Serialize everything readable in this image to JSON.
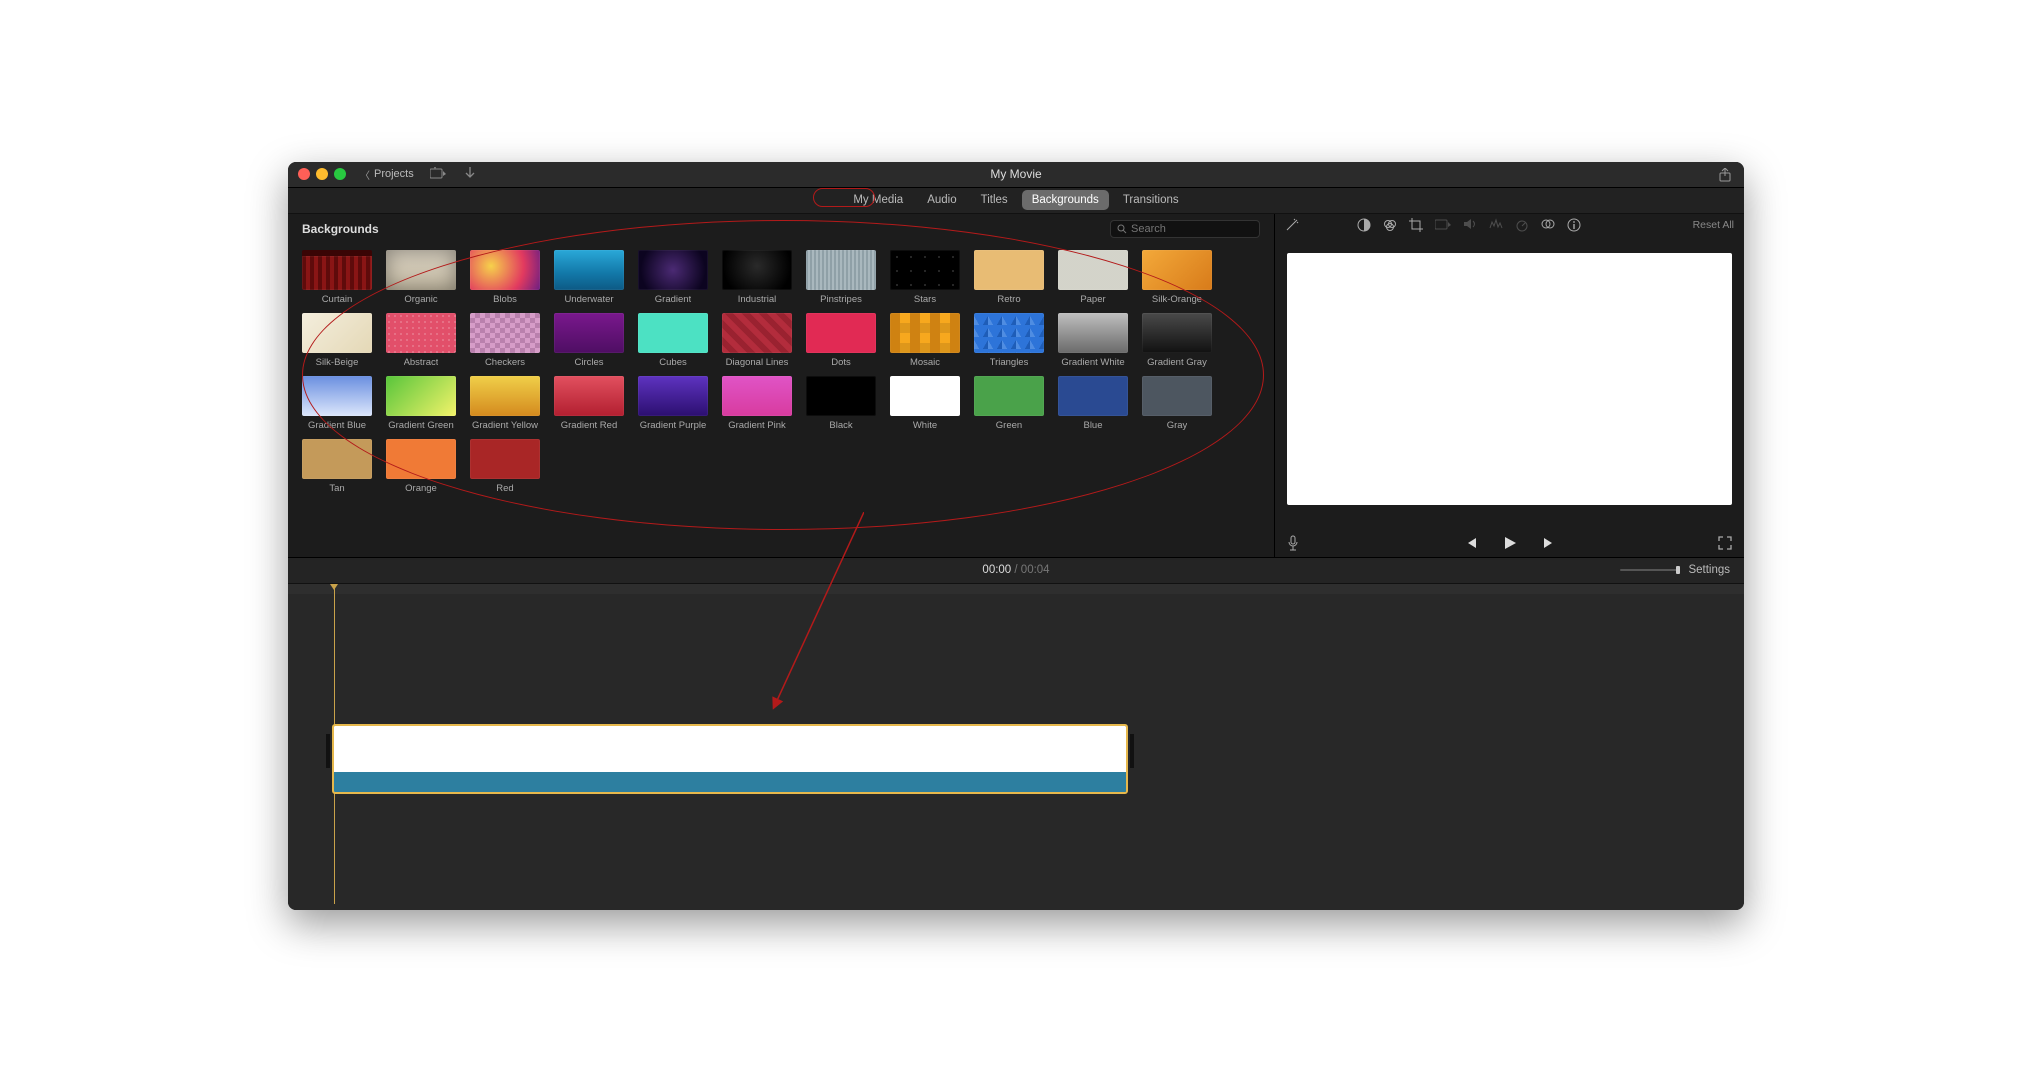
{
  "window_title": "My Movie",
  "titlebar": {
    "projects_label": "Projects"
  },
  "tabs": [
    {
      "label": "My Media",
      "active": false
    },
    {
      "label": "Audio",
      "active": false
    },
    {
      "label": "Titles",
      "active": false
    },
    {
      "label": "Backgrounds",
      "active": true
    },
    {
      "label": "Transitions",
      "active": false
    }
  ],
  "browser": {
    "heading": "Backgrounds",
    "search_placeholder": "Search",
    "items": [
      {
        "name": "Curtain",
        "class": "pat-curtain"
      },
      {
        "name": "Organic",
        "class": "pat-organic"
      },
      {
        "name": "Blobs",
        "style": "background: radial-gradient(circle at 30% 40%, #f6d14b, #e23a5f 60%, #6b1e83);"
      },
      {
        "name": "Underwater",
        "style": "background: linear-gradient(180deg,#2aa8d8 0%, #1277a7 60%, #0d5a85 100%);"
      },
      {
        "name": "Gradient",
        "style": "background: radial-gradient(circle at 50% 50%, #4b2a74, #0c0420 80%);"
      },
      {
        "name": "Industrial",
        "style": "background: radial-gradient(circle at 50% 40%, #2a2a2a, #000 80%);"
      },
      {
        "name": "Pinstripes",
        "class": "pat-pinstripes"
      },
      {
        "name": "Stars",
        "class": "pat-stars"
      },
      {
        "name": "Retro",
        "style": "background: #e8bc74;"
      },
      {
        "name": "Paper",
        "class": "pat-paper"
      },
      {
        "name": "Silk-Orange",
        "style": "background: linear-gradient(135deg,#f3a93a,#d87b1a);"
      },
      {
        "name": "Silk-Beige",
        "style": "background: linear-gradient(135deg,#f4eedd,#e4d8b6);"
      },
      {
        "name": "Abstract",
        "class": "pat-abstract"
      },
      {
        "name": "Checkers",
        "class": "pat-checkers"
      },
      {
        "name": "Circles",
        "style": "background: linear-gradient(180deg,#7a188d,#4e0e63);"
      },
      {
        "name": "Cubes",
        "style": "background: #4ce1c3;"
      },
      {
        "name": "Diagonal Lines",
        "class": "pat-diag"
      },
      {
        "name": "Dots",
        "style": "background: #e12a54;"
      },
      {
        "name": "Mosaic",
        "class": "pat-mosaic"
      },
      {
        "name": "Triangles",
        "class": "pat-triangles"
      },
      {
        "name": "Gradient White",
        "style": "background: linear-gradient(180deg,#bfbfbf,#6a6a6a);"
      },
      {
        "name": "Gradient Gray",
        "style": "background: linear-gradient(180deg,#4a4a4a,#111);"
      },
      {
        "name": "Gradient Blue",
        "style": "background: linear-gradient(180deg,#6a8fe0,#dce6fb);"
      },
      {
        "name": "Gradient Green",
        "style": "background: linear-gradient(135deg,#58c53b,#f3f36a);"
      },
      {
        "name": "Gradient Yellow",
        "style": "background: linear-gradient(180deg,#f0cf49,#d48a1e);"
      },
      {
        "name": "Gradient Red",
        "style": "background: linear-gradient(180deg,#e2505f,#b21f30);"
      },
      {
        "name": "Gradient Purple",
        "style": "background: linear-gradient(180deg,#5e33c0,#2c0f70);"
      },
      {
        "name": "Gradient Pink",
        "style": "background: linear-gradient(180deg,#e054c6,#d83b9f);"
      },
      {
        "name": "Black",
        "style": "background: #000;"
      },
      {
        "name": "White",
        "style": "background: #fff;"
      },
      {
        "name": "Green",
        "style": "background: #4aa24a;"
      },
      {
        "name": "Blue",
        "style": "background: #2a4a92;"
      },
      {
        "name": "Gray",
        "style": "background: #4d5660;"
      },
      {
        "name": "Tan",
        "style": "background: #c49a5a;"
      },
      {
        "name": "Orange",
        "style": "background: #f07a36;"
      },
      {
        "name": "Red",
        "style": "background: #a92626;"
      }
    ]
  },
  "preview": {
    "reset_label": "Reset All"
  },
  "timecode": {
    "current": "00:00",
    "total": "00:04"
  },
  "timeline": {
    "settings_label": "Settings"
  }
}
